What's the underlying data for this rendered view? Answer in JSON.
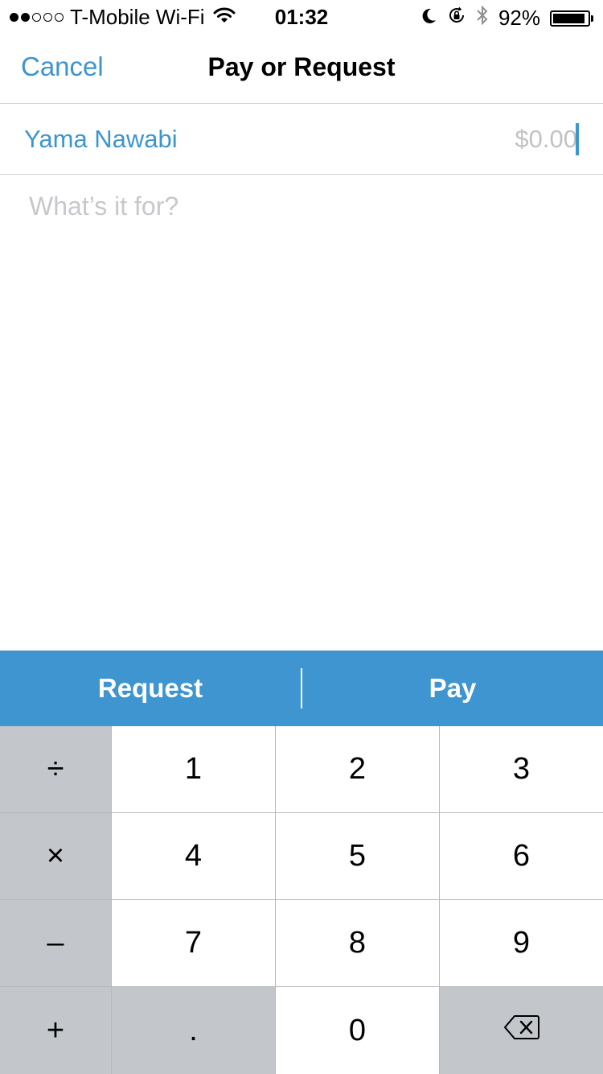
{
  "status_bar": {
    "signal_filled": 2,
    "signal_empty": 3,
    "carrier": "T-Mobile Wi-Fi",
    "time": "01:32",
    "battery_percent": "92%",
    "battery_level": 0.92,
    "icons": [
      "wifi-icon",
      "moon-icon",
      "rotation-lock-icon",
      "bluetooth-icon",
      "battery-icon"
    ]
  },
  "nav": {
    "cancel_label": "Cancel",
    "title": "Pay or Request"
  },
  "form": {
    "recipient": "Yama Nawabi",
    "amount_placeholder": "$0.00",
    "note_placeholder": "What’s it for?"
  },
  "actions": {
    "request_label": "Request",
    "pay_label": "Pay"
  },
  "keypad": {
    "operators": [
      "÷",
      "×",
      "–",
      "+"
    ],
    "rows": [
      [
        "1",
        "2",
        "3"
      ],
      [
        "4",
        "5",
        "6"
      ],
      [
        "7",
        "8",
        "9"
      ],
      [
        ".",
        "0",
        "backspace-icon"
      ]
    ]
  },
  "colors": {
    "accent": "#3d95ce",
    "action_bar": "#3e95cf",
    "placeholder": "#c7c7cd",
    "key_dark": "#c3c6ca",
    "key_light": "#ffffff"
  }
}
